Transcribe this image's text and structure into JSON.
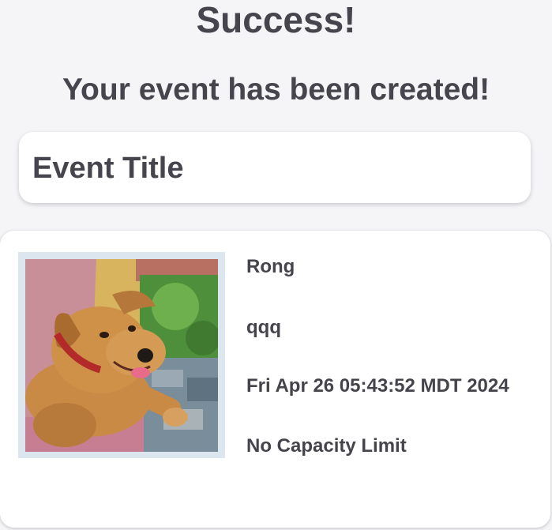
{
  "header": {
    "title": "Success!",
    "subtitle": "Your event has been created!"
  },
  "event_title_card": {
    "text": "Event Title"
  },
  "event_details": {
    "organizer": "Rong",
    "description": "qqq",
    "date": "Fri Apr 26 05:43:52 MDT 2024",
    "capacity": "No Capacity Limit"
  },
  "colors": {
    "background": "#f5f4f7",
    "card": "#ffffff",
    "text": "#45444b",
    "photo_frame": "#dbe6ee"
  }
}
